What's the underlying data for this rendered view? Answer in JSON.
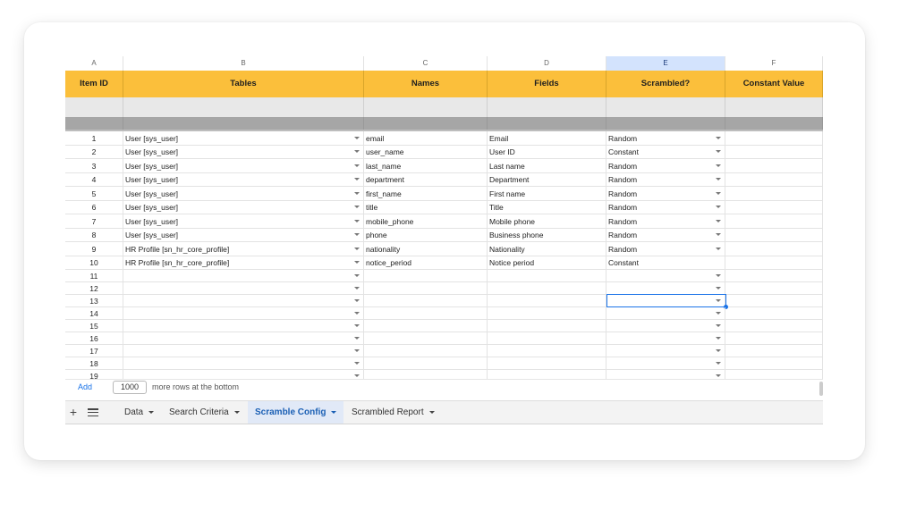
{
  "columns": [
    {
      "letter": "A",
      "header": "Item ID"
    },
    {
      "letter": "B",
      "header": "Tables"
    },
    {
      "letter": "C",
      "header": "Names"
    },
    {
      "letter": "D",
      "header": "Fields"
    },
    {
      "letter": "E",
      "header": "Scrambled?"
    },
    {
      "letter": "F",
      "header": "Constant Value"
    }
  ],
  "selected_column": "E",
  "rows": [
    {
      "num": "1",
      "table": "User [sys_user]",
      "name": "email",
      "field": "Email",
      "scrambled": "Random",
      "constant": "",
      "dd_table": true,
      "dd_scr": true
    },
    {
      "num": "2",
      "table": "User [sys_user]",
      "name": "user_name",
      "field": "User ID",
      "scrambled": "Constant",
      "constant": "",
      "dd_table": true,
      "dd_scr": true
    },
    {
      "num": "3",
      "table": "User [sys_user]",
      "name": "last_name",
      "field": "Last name",
      "scrambled": "Random",
      "constant": "",
      "dd_table": true,
      "dd_scr": true
    },
    {
      "num": "4",
      "table": "User [sys_user]",
      "name": "department",
      "field": "Department",
      "scrambled": "Random",
      "constant": "",
      "dd_table": true,
      "dd_scr": true
    },
    {
      "num": "5",
      "table": "User [sys_user]",
      "name": "first_name",
      "field": "First name",
      "scrambled": "Random",
      "constant": "",
      "dd_table": true,
      "dd_scr": true
    },
    {
      "num": "6",
      "table": "User [sys_user]",
      "name": "title",
      "field": "Title",
      "scrambled": "Random",
      "constant": "",
      "dd_table": true,
      "dd_scr": true
    },
    {
      "num": "7",
      "table": "User [sys_user]",
      "name": "mobile_phone",
      "field": "Mobile phone",
      "scrambled": "Random",
      "constant": "",
      "dd_table": true,
      "dd_scr": true
    },
    {
      "num": "8",
      "table": "User [sys_user]",
      "name": "phone",
      "field": "Business phone",
      "scrambled": "Random",
      "constant": "",
      "dd_table": true,
      "dd_scr": true
    },
    {
      "num": "9",
      "table": "HR Profile [sn_hr_core_profile]",
      "name": "nationality",
      "field": "Nationality",
      "scrambled": "Random",
      "constant": "",
      "dd_table": true,
      "dd_scr": true
    },
    {
      "num": "10",
      "table": "HR Profile [sn_hr_core_profile]",
      "name": "notice_period",
      "field": "Notice period",
      "scrambled": "Constant",
      "constant": "",
      "dd_table": true,
      "dd_scr": false
    },
    {
      "num": "11",
      "table": "",
      "name": "",
      "field": "",
      "scrambled": "",
      "constant": "",
      "dd_table": true,
      "dd_scr": true
    },
    {
      "num": "12",
      "table": "",
      "name": "",
      "field": "",
      "scrambled": "",
      "constant": "",
      "dd_table": true,
      "dd_scr": true
    },
    {
      "num": "13",
      "table": "",
      "name": "",
      "field": "",
      "scrambled": "",
      "constant": "",
      "dd_table": true,
      "dd_scr": true,
      "selected": true
    },
    {
      "num": "14",
      "table": "",
      "name": "",
      "field": "",
      "scrambled": "",
      "constant": "",
      "dd_table": true,
      "dd_scr": true
    },
    {
      "num": "15",
      "table": "",
      "name": "",
      "field": "",
      "scrambled": "",
      "constant": "",
      "dd_table": true,
      "dd_scr": true
    },
    {
      "num": "16",
      "table": "",
      "name": "",
      "field": "",
      "scrambled": "",
      "constant": "",
      "dd_table": true,
      "dd_scr": true
    },
    {
      "num": "17",
      "table": "",
      "name": "",
      "field": "",
      "scrambled": "",
      "constant": "",
      "dd_table": true,
      "dd_scr": true
    },
    {
      "num": "18",
      "table": "",
      "name": "",
      "field": "",
      "scrambled": "",
      "constant": "",
      "dd_table": true,
      "dd_scr": true
    },
    {
      "num": "19",
      "table": "",
      "name": "",
      "field": "",
      "scrambled": "",
      "constant": "",
      "dd_table": true,
      "dd_scr": true
    }
  ],
  "add_rows": {
    "button": "Add",
    "count": "1000",
    "text": "more rows at the bottom"
  },
  "tabs": [
    {
      "label": "Data",
      "active": false
    },
    {
      "label": "Search Criteria",
      "active": false
    },
    {
      "label": "Scramble Config",
      "active": true
    },
    {
      "label": "Scrambled Report",
      "active": false
    }
  ],
  "icons": {
    "add_sheet": "plus-icon",
    "all_sheets": "menu-icon",
    "dropdown": "caret-down-icon"
  },
  "colors": {
    "header_bg": "#fbbf3b",
    "selection": "#1a73e8",
    "active_tab": "#1a5fb4"
  }
}
